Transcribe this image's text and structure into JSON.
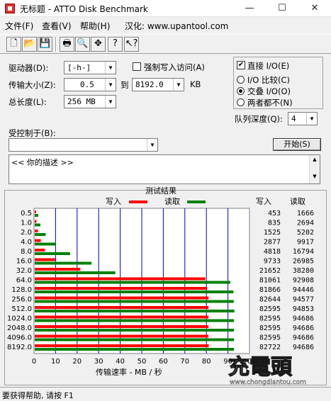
{
  "window": {
    "title": "无标题 - ATTO Disk Benchmark",
    "min": "—",
    "max": "☐",
    "close": "✕"
  },
  "menu": {
    "file": "文件(F)",
    "view": "查看(V)",
    "help": "帮助(H)",
    "localize": "汉化: www.upantool.com"
  },
  "toolbar": {
    "icons": [
      "new-icon",
      "open-icon",
      "save-icon",
      "print-icon",
      "print-preview-icon",
      "move-icon",
      "help-icon",
      "context-help-icon"
    ]
  },
  "form": {
    "drive_label": "驱动器(D):",
    "drive_value": "[-h-]",
    "force_write_label": "强制写入访问(A)",
    "transfer_label": "传输大小(Z):",
    "transfer_from": "0.5",
    "to_label": "到",
    "transfer_to": "8192.0",
    "kb": "KB",
    "total_label": "总长度(L):",
    "total_value": "256 MB",
    "direct_io_label": "直接 I/O(E)",
    "direct_io_checked": true,
    "io_compare_label": "I/O 比较(C)",
    "alternate_label": "交叠 I/O(O)",
    "neither_label": "两者都不(N)",
    "selected_mode": "alternate",
    "queue_label": "队列深度(Q):",
    "queue_value": "4",
    "controlled_label": "受控制于(B):",
    "controlled_value": "",
    "start_label": "开始(S)",
    "description": "<<  你的描述   >>"
  },
  "results": {
    "title": "测试结果",
    "legend_write": "写入",
    "legend_read": "读取",
    "col_write": "写入",
    "col_read": "读取",
    "xlabel": "传输速率 - MB / 秒"
  },
  "chart_data": {
    "type": "bar",
    "orientation": "horizontal",
    "title": "测试结果",
    "xlabel": "传输速率 - MB / 秒",
    "xlim": [
      0,
      100
    ],
    "xticks": [
      "0",
      "10",
      "20",
      "30",
      "40",
      "50",
      "60",
      "70",
      "80",
      "90",
      "100"
    ],
    "categories": [
      "0.5",
      "1.0",
      "2.0",
      "4.0",
      "8.0",
      "16.0",
      "32.0",
      "64.0",
      "128.0",
      "256.0",
      "512.0",
      "1024.0",
      "2048.0",
      "4096.0",
      "8192.0"
    ],
    "series": [
      {
        "name": "写入",
        "color": "#ff0000",
        "values": [
          453,
          835,
          1525,
          2877,
          4818,
          9733,
          21652,
          81061,
          81866,
          82644,
          82595,
          82595,
          82595,
          82595,
          82722
        ]
      },
      {
        "name": "读取",
        "color": "#008000",
        "values": [
          1666,
          2694,
          5202,
          9917,
          16794,
          26985,
          38280,
          92908,
          94446,
          94577,
          94853,
          94686,
          94686,
          94686,
          94686
        ]
      }
    ],
    "units_note": "values in KB/s"
  },
  "status": {
    "text": "要获得帮助, 请按 F1"
  },
  "watermark": {
    "brand": "充電頭",
    "url": "www.chongdiantou.com"
  },
  "colors": {
    "grid_blue": "#0000c0",
    "write": "#ff0000",
    "read": "#008000"
  }
}
